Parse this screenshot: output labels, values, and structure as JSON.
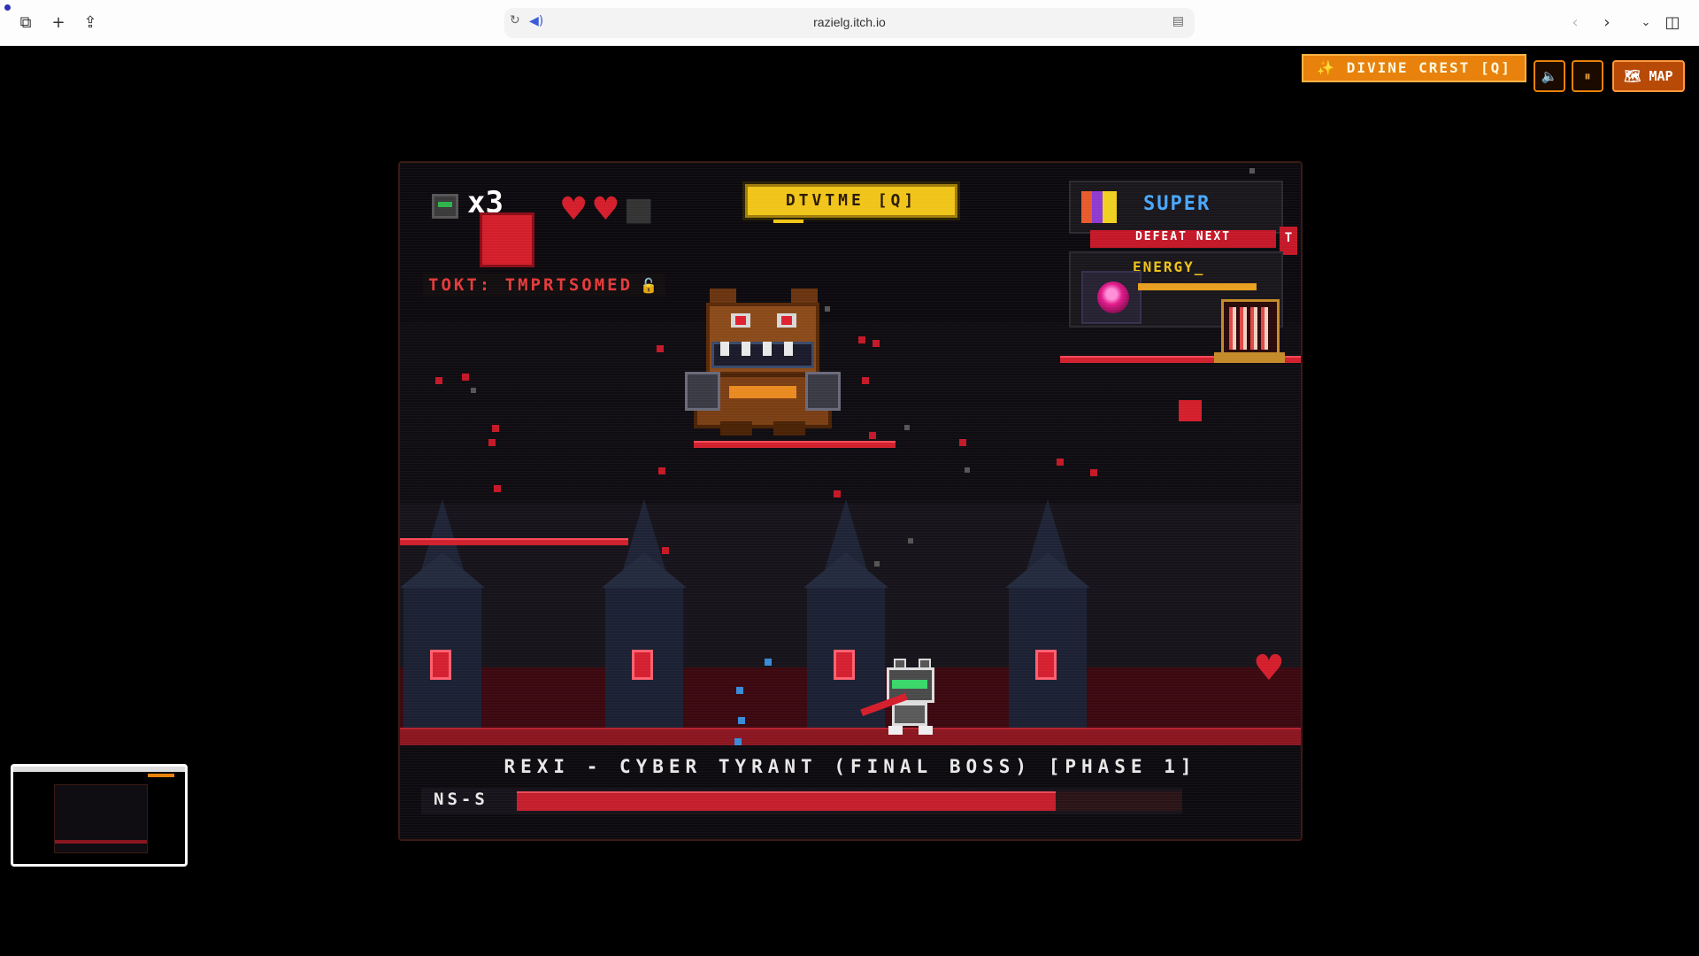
{
  "browser": {
    "url": "razielg.itch.io"
  },
  "controls": {
    "crest_label": "✨ DIVINE CREST [Q]",
    "sound_icon": "🔈",
    "pause_icon": "⏸",
    "map_label": "🗺 MAP"
  },
  "hud": {
    "lives": "x3",
    "hearts_full": 2,
    "hearts_total": 3,
    "token_text": "TOKT: TMPRTSOMED",
    "divine_label": "DTVTME [Q]",
    "super_label": "SUPER",
    "defeat_text": "DEFEAT NEXT",
    "t_badge": "T",
    "energy_label": "ENERGY_"
  },
  "boss": {
    "name": "REXI - CYBER TYRANT (FINAL BOSS) [PHASE 1]",
    "hp_label": "NS-S",
    "hp_fraction": 0.81
  },
  "colors": {
    "accent_orange": "#e8820c",
    "boss_red": "#c41e2c",
    "divine_yellow": "#f0c419",
    "super_blue": "#4aa8ff"
  }
}
